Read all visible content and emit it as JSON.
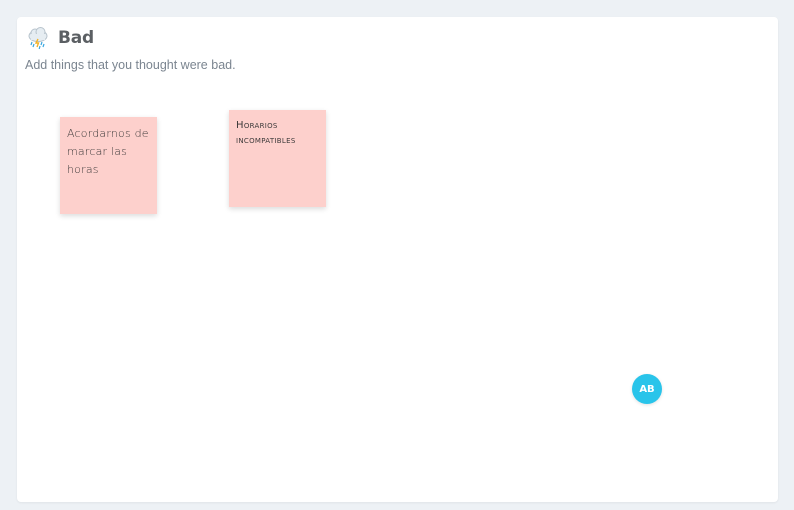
{
  "column": {
    "icon": "rain-cloud-icon",
    "title": "Bad",
    "subtitle": "Add things that you thought were bad."
  },
  "notes": [
    {
      "text": "Acordarnos de marcar las horas",
      "color": "#fdd0cc"
    },
    {
      "text": "Horarios incompatibles",
      "color": "#fdd0cc"
    }
  ],
  "avatar": {
    "initials": "AB",
    "color": "#29c4ea"
  }
}
